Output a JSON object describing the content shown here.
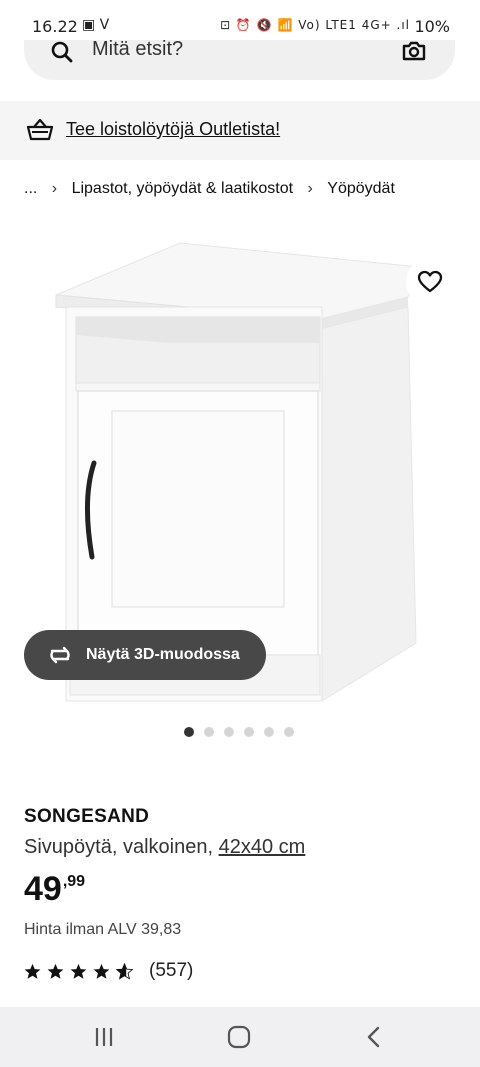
{
  "status_bar": {
    "time": "16.22",
    "left_icons": "▣ V",
    "right_icons": "⊡ ⏰ 🔇 📶 Vo) LTE1 4G+ .ıl",
    "battery": "10%"
  },
  "search": {
    "placeholder": "Mitä etsit?",
    "icon": "search-icon",
    "camera_icon": "camera-icon"
  },
  "outlet_banner": {
    "icon": "basket-icon",
    "link_text": "Tee loistolöytöjä Outletista!"
  },
  "breadcrumb": {
    "ellipsis": "...",
    "items": [
      "Lipastot, yöpöydät & laatikostot",
      "Yöpöydät"
    ]
  },
  "product_image": {
    "favorite_icon": "heart-icon",
    "view3d_label": "Näytä 3D-muodossa",
    "dots_total": 6,
    "dots_active_index": 0
  },
  "product": {
    "name": "SONGESAND",
    "description": "Sivupöytä, valkoinen,",
    "size": "42x40 cm",
    "price_int": "49",
    "price_dec": ",99",
    "price_vat": "Hinta ilman ALV 39,83",
    "rating_stars": 4.5,
    "rating_count": "(557)"
  },
  "colors": {
    "accent_dark": "#484848",
    "background_light": "#f5f5f5"
  }
}
